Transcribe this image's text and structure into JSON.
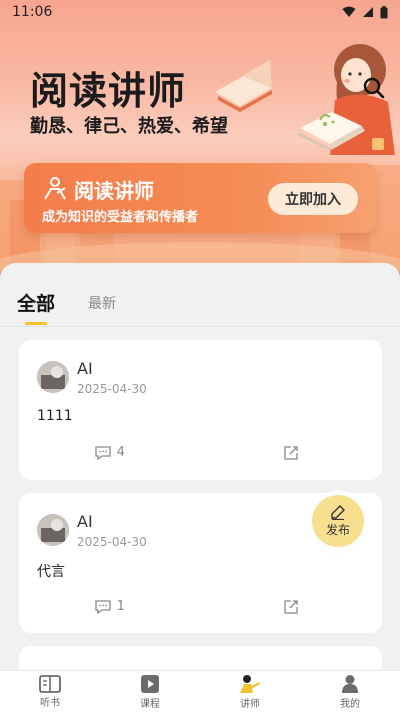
{
  "status_bar": {
    "time": "11:06"
  },
  "banner": {
    "title": "阅读讲师",
    "subtitle": "勤恳、律己、热爱、希望"
  },
  "join_card": {
    "title": "阅读讲师",
    "subtitle": "成为知识的受益者和传播者",
    "button_label": "立即加入"
  },
  "tabs": [
    {
      "label": "全部",
      "active": true
    },
    {
      "label": "最新",
      "active": false
    }
  ],
  "posts": [
    {
      "author": "AI",
      "date": "2025-04-30",
      "content": "1111",
      "comment_count": "4"
    },
    {
      "author": "AI",
      "date": "2025-04-30",
      "content": "代言",
      "comment_count": "1"
    }
  ],
  "fab": {
    "label": "发布"
  },
  "bottom_nav": [
    {
      "label": "听书",
      "icon": "book-icon",
      "active": false
    },
    {
      "label": "课程",
      "icon": "play-icon",
      "active": false
    },
    {
      "label": "讲师",
      "icon": "lecturer-icon",
      "active": true
    },
    {
      "label": "我的",
      "icon": "profile-icon",
      "active": false
    }
  ],
  "colors": {
    "accent": "#f2c230",
    "banner_orange": "#f47c4b"
  }
}
